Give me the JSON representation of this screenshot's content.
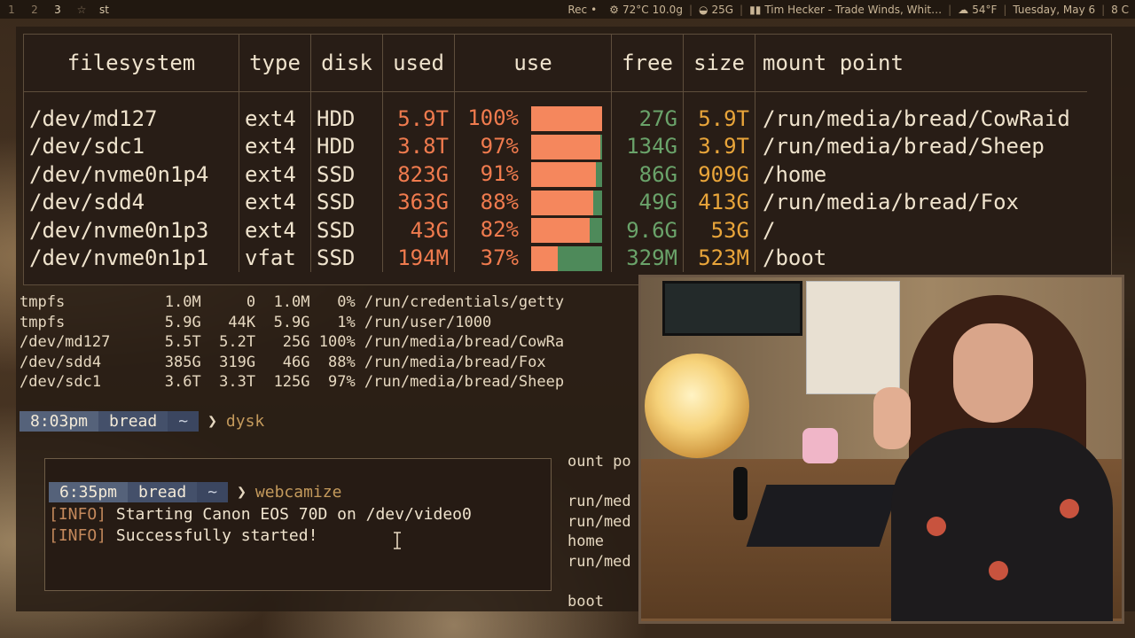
{
  "topbar": {
    "workspaces": [
      "1",
      "2",
      "3"
    ],
    "active_workspace": "3",
    "star_icon": "star-icon",
    "window_title": "st",
    "rec": "Rec",
    "rec_dot": "•",
    "cpu_temp": "72°C",
    "memory": "10.0g",
    "disk_free": "25G",
    "music": "Tim Hecker - Trade Winds, Whit…",
    "weather": "54°F",
    "date": "Tuesday, May  6",
    "extra": "8 C"
  },
  "dysk": {
    "headers": [
      "filesystem",
      "type",
      "disk",
      "used",
      "use",
      "free",
      "size",
      "mount point"
    ],
    "rows": [
      {
        "fs": "/dev/md127",
        "type": "ext4",
        "disk": "HDD",
        "used": "5.9T",
        "pct": "100%",
        "use": 1.0,
        "free": "27G",
        "size": "5.9T",
        "mount": "/run/media/bread/CowRaid"
      },
      {
        "fs": "/dev/sdc1",
        "type": "ext4",
        "disk": "HDD",
        "used": "3.8T",
        "pct": "97%",
        "use": 0.97,
        "free": "134G",
        "size": "3.9T",
        "mount": "/run/media/bread/Sheep"
      },
      {
        "fs": "/dev/nvme0n1p4",
        "type": "ext4",
        "disk": "SSD",
        "used": "823G",
        "pct": "91%",
        "use": 0.91,
        "free": "86G",
        "size": "909G",
        "mount": "/home"
      },
      {
        "fs": "/dev/sdd4",
        "type": "ext4",
        "disk": "SSD",
        "used": "363G",
        "pct": "88%",
        "use": 0.88,
        "free": "49G",
        "size": "413G",
        "mount": "/run/media/bread/Fox"
      },
      {
        "fs": "/dev/nvme0n1p3",
        "type": "ext4",
        "disk": "SSD",
        "used": "43G",
        "pct": "82%",
        "use": 0.82,
        "free": "9.6G",
        "size": "53G",
        "mount": "/"
      },
      {
        "fs": "/dev/nvme0n1p1",
        "type": "vfat",
        "disk": "SSD",
        "used": "194M",
        "pct": "37%",
        "use": 0.37,
        "free": "329M",
        "size": "523M",
        "mount": "/boot"
      }
    ]
  },
  "back_terminal": {
    "lines": [
      "tmpfs           1.0M     0  1.0M   0% /run/credentials/getty",
      "tmpfs           5.9G   44K  5.9G   1% /run/user/1000",
      "/dev/md127      5.5T  5.2T   25G 100% /run/media/bread/CowRa",
      "/dev/sdd4       385G  319G   46G  88% /run/media/bread/Fox",
      "/dev/sdc1       3.6T  3.3T  125G  97% /run/media/bread/Sheep"
    ],
    "prompt": {
      "time": "8:03pm",
      "user": "bread",
      "dir": "~",
      "arrow": "❯",
      "command": "dysk"
    },
    "right_lines": [
      "ount po",
      "",
      "run/med",
      "run/med",
      "home",
      "run/med",
      "",
      "boot"
    ]
  },
  "front_terminal": {
    "prompt": {
      "time": "6:35pm",
      "user": "bread",
      "dir": "~",
      "arrow": "❯",
      "command": "webcamize"
    },
    "lines": [
      {
        "tag": "[INFO]",
        "text": " Starting Canon EOS 70D on /dev/video0"
      },
      {
        "tag": "[INFO]",
        "text": " Successfully started!"
      }
    ]
  },
  "colors": {
    "used": "#f07b4e",
    "free": "#6aa36a",
    "size": "#e9a53a",
    "bar_fill": "#f5875d",
    "bar_bg": "#4e8a5a",
    "prompt_bg": "#55627a"
  }
}
